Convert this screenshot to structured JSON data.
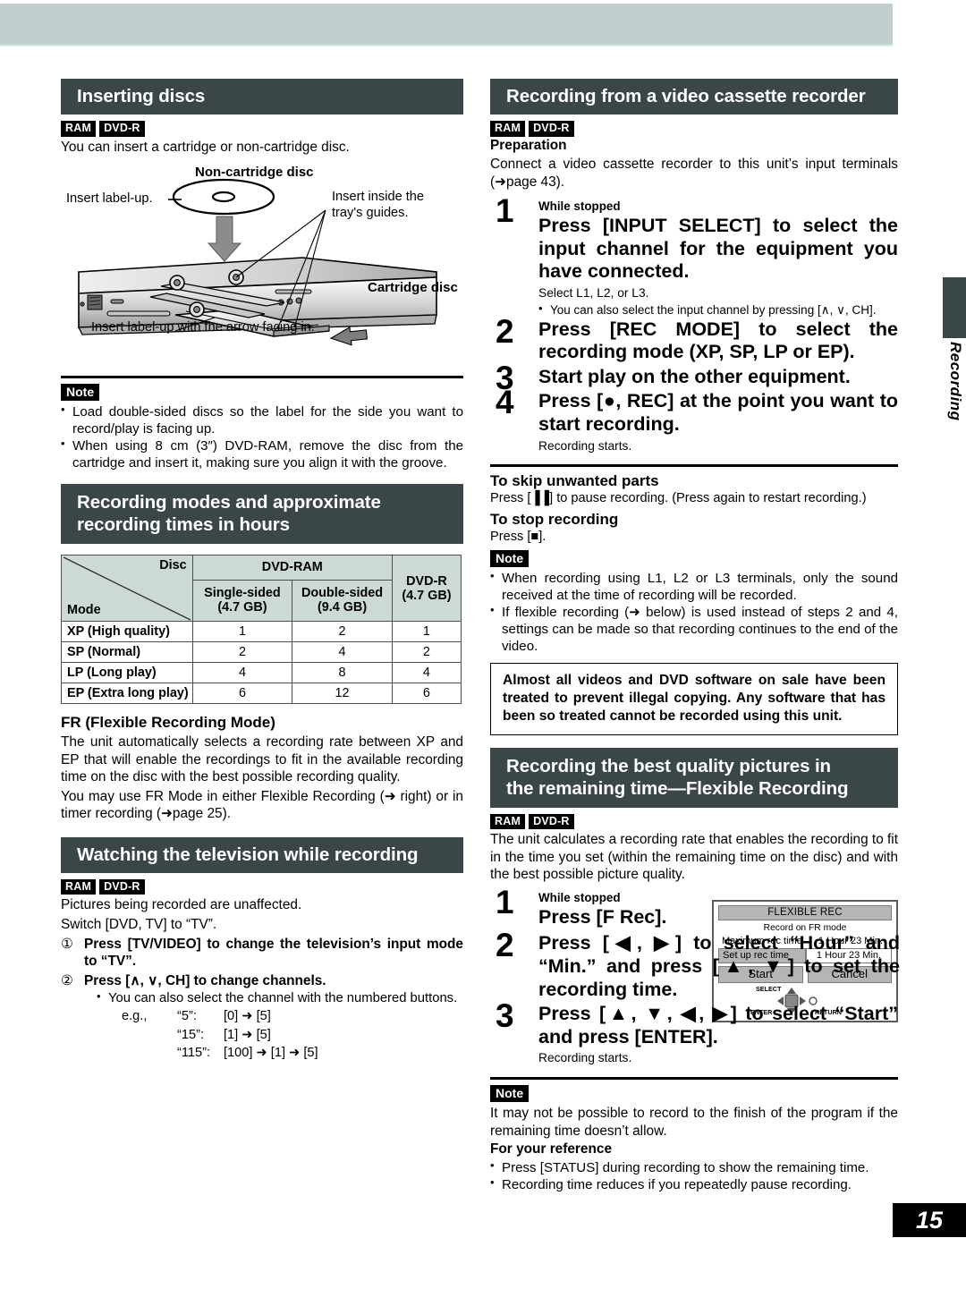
{
  "page": {
    "number": "15",
    "edge_tab_label": "Recording"
  },
  "left_column": {
    "section1": {
      "heading": "Inserting discs",
      "badges": [
        "RAM",
        "DVD-R"
      ],
      "intro": "You can insert a cartridge or non-cartridge disc.",
      "illustration": {
        "title": "Non-cartridge disc",
        "label_left": "Insert label-up.",
        "label_right": "Insert inside the tray's guides.",
        "label_cartridge": "Cartridge disc",
        "label_bottom": "Insert label-up with the arrow facing in."
      },
      "note_tag": "Note",
      "notes": [
        "Load double-sided discs so the label for the side you want to record/play is facing up.",
        "When using 8 cm (3″) DVD-RAM, remove the disc from the cartridge and insert it, making sure you align it with the groove."
      ]
    },
    "section2": {
      "heading_line1": "Recording modes and approximate",
      "heading_line2": "recording times in hours",
      "table": {
        "corner_top": "Disc",
        "corner_bottom": "Mode",
        "group_header": "DVD-RAM",
        "columns": [
          "Single-sided (4.7 GB)",
          "Double-sided (9.4 GB)",
          "DVD-R (4.7 GB)"
        ],
        "col_dvdr_line1": "DVD-R",
        "col_dvdr_line2": "(4.7 GB)",
        "col_single_line1": "Single-sided",
        "col_single_line2": "(4.7 GB)",
        "col_double_line1": "Double-sided",
        "col_double_line2": "(9.4 GB)",
        "rows": [
          {
            "mode": "XP (High quality)",
            "single": "1",
            "double": "2",
            "dvdr": "1"
          },
          {
            "mode": "SP (Normal)",
            "single": "2",
            "double": "4",
            "dvdr": "2"
          },
          {
            "mode": "LP (Long play)",
            "single": "4",
            "double": "8",
            "dvdr": "4"
          },
          {
            "mode": "EP (Extra long play)",
            "single": "6",
            "double": "12",
            "dvdr": "6"
          }
        ]
      },
      "fr_heading": "FR (Flexible Recording Mode)",
      "fr_para1": "The unit automatically selects a recording rate between XP and EP that will enable the recordings to fit in the available recording time on the disc with the best possible recording quality.",
      "fr_para2": "You may use FR Mode in either Flexible Recording (➜ right) or in timer recording (➜page 25)."
    },
    "section3": {
      "heading": "Watching the television while recording",
      "badges": [
        "RAM",
        "DVD-R"
      ],
      "line1": "Pictures being recorded are unaffected.",
      "line2": "Switch [DVD, TV] to “TV”.",
      "step1_marker": "①",
      "step1": "Press [TV/VIDEO] to change the television’s input mode to “TV”.",
      "step2_marker": "②",
      "step2": "Press [∧, ∨, CH] to change channels.",
      "step2_note": "You can also select the channel with the numbered buttons.",
      "eg_label": "e.g.,",
      "examples": [
        {
          "channel": "“5”:",
          "keys": "[0] ➜ [5]"
        },
        {
          "channel": "“15”:",
          "keys": "[1] ➜ [5]"
        },
        {
          "channel": "“115”:",
          "keys": "[100] ➜ [1] ➜ [5]"
        }
      ]
    }
  },
  "right_column": {
    "section1": {
      "heading": "Recording from a video cassette recorder",
      "badges": [
        "RAM",
        "DVD-R"
      ],
      "preparation_label": "Preparation",
      "preparation_text": "Connect a video cassette recorder to this unit’s input terminals (➜page 43).",
      "steps": [
        {
          "num": "1",
          "pre": "While stopped",
          "instruction": "Press [INPUT SELECT] to select the input channel for the equipment you have connected.",
          "sub": "Select L1, L2, or L3.",
          "bullets": [
            "You can also select the input channel by pressing [∧, ∨, CH]."
          ]
        },
        {
          "num": "2",
          "pre": "",
          "instruction": "Press [REC MODE] to select the recording mode (XP, SP, LP or EP).",
          "sub": "",
          "bullets": []
        },
        {
          "num": "3",
          "pre": "",
          "instruction": "Start play on the other equipment.",
          "sub": "",
          "bullets": []
        },
        {
          "num": "4",
          "pre": "",
          "instruction": "Press [●, REC] at the point you want to start recording.",
          "sub": "Recording starts.",
          "bullets": []
        }
      ],
      "skip_heading": "To skip unwanted parts",
      "skip_text": "Press [▐▐] to pause recording. (Press again to restart recording.)",
      "stop_heading": "To stop recording",
      "stop_text": "Press [■].",
      "note_tag": "Note",
      "notes": [
        "When recording using L1, L2 or L3 terminals, only the sound received at the time of recording will be recorded.",
        "If flexible recording (➜ below) is used instead of steps 2 and 4, settings can be made so that recording continues to the end of the video."
      ],
      "warning": "Almost all videos and DVD software on sale have been treated to prevent illegal copying. Any software that has been so treated cannot be recorded using this unit."
    },
    "section2": {
      "heading_line1": "Recording the best quality pictures in",
      "heading_line2": "the remaining time—Flexible Recording",
      "badges": [
        "RAM",
        "DVD-R"
      ],
      "intro": "The unit calculates a recording rate that enables the recording to fit in the time you set (within the remaining time on the disc) and with the best possible picture quality.",
      "steps": [
        {
          "num": "1",
          "pre": "While stopped",
          "instruction": "Press [F Rec].",
          "sub": ""
        },
        {
          "num": "2",
          "pre": "",
          "instruction": "Press [◀, ▶] to select “Hour” and “Min.” and press [▲, ▼] to set the recording time.",
          "sub": ""
        },
        {
          "num": "3",
          "pre": "",
          "instruction": "Press [▲, ▼, ◀, ▶] to select “Start” and press [ENTER].",
          "sub": "Recording starts."
        }
      ],
      "osd": {
        "title": "FLEXIBLE REC",
        "subtitle": "Record on FR mode",
        "max_label": "Maximum rec time",
        "max_value": "1 Hour 23 Min.",
        "setup_label": "Set up rec time",
        "setup_value": "1 Hour 23 Min.",
        "start_button": "Start",
        "cancel_button": "Cancel",
        "nav_select": "SELECT",
        "nav_enter": "ENTER",
        "nav_return": "RETURN"
      },
      "note_tag": "Note",
      "note_text": "It may not be possible to record to the finish of the program if the remaining time doesn’t allow.",
      "reference_heading": "For your reference",
      "reference_bullets": [
        "Press [STATUS] during recording to show the remaining time.",
        "Recording time reduces if you repeatedly pause recording."
      ]
    }
  }
}
